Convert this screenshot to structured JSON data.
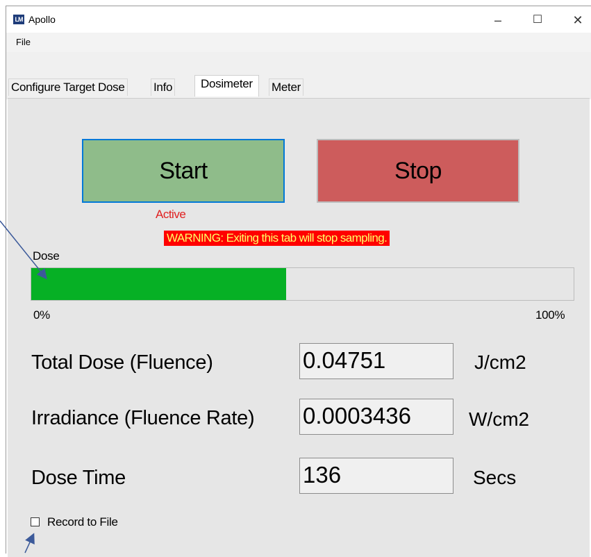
{
  "window": {
    "title": "Apollo",
    "icon_text": "LM",
    "controls": {
      "minimize": "–",
      "maximize": "☐",
      "close": "✕"
    }
  },
  "menu": {
    "items": [
      "File"
    ]
  },
  "tabs": [
    {
      "label": "Configure Target Dose",
      "active": false
    },
    {
      "label": "Info",
      "active": false
    },
    {
      "label": "Dosimeter",
      "active": true
    },
    {
      "label": "Meter",
      "active": false
    }
  ],
  "buttons": {
    "start": "Start",
    "stop": "Stop"
  },
  "status": "Active",
  "warning": "WARNING: Exiting this tab will stop sampling.",
  "dose_bar": {
    "label": "Dose",
    "min_label": "0%",
    "max_label": "100%",
    "fill_fraction": 0.47,
    "fill_color": "#06b025"
  },
  "readings": [
    {
      "label": "Total Dose (Fluence)",
      "value": "0.04751",
      "unit": "J/cm2"
    },
    {
      "label": "Irradiance (Fluence Rate)",
      "value": "0.0003436",
      "unit": "W/cm2"
    },
    {
      "label": "Dose Time",
      "value": "136",
      "unit": "Secs"
    }
  ],
  "record_to_file": {
    "label": "Record to File",
    "checked": false
  },
  "colors": {
    "start_button": "#8fbc8a",
    "stop_button": "#cd5c5c",
    "status_text": "#e02020",
    "warning_bg": "#ff0000",
    "warning_text": "#ffff66",
    "annotation_arrow": "#3c5a9a"
  }
}
